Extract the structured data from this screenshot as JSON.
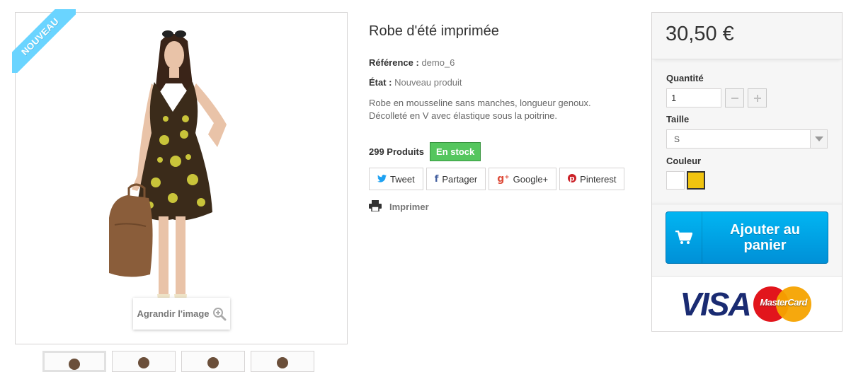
{
  "product": {
    "badge": "Nouveau",
    "zoom_label": "Agrandir l'image",
    "title": "Robe d'été imprimée",
    "reference_label": "Référence :",
    "reference_value": "demo_6",
    "condition_label": "État :",
    "condition_value": "Nouveau produit",
    "description_line1": "Robe en mousseline sans manches, longueur genoux.",
    "description_line2": "Décolleté en V avec élastique sous la poitrine.",
    "quantity_text": "299 Produits",
    "stock_badge": "En stock",
    "share": {
      "tweet": "Tweet",
      "partager": "Partager",
      "google": "Google+",
      "pinterest": "Pinterest"
    },
    "print_label": "Imprimer"
  },
  "buy_box": {
    "price": "30,50 €",
    "quantity_label": "Quantité",
    "quantity_value": "1",
    "size_label": "Taille",
    "size_value": "S",
    "color_label": "Couleur",
    "colors": [
      "#ffffff",
      "#f1c40f"
    ],
    "selected_color_index": 1,
    "add_to_cart": "Ajouter au panier",
    "payment_logos": [
      "VISA",
      "MasterCard"
    ]
  },
  "colors": {
    "ribbon": "#6ad4ff",
    "stock_green": "#55c65e",
    "cart_blue": "#0090d7"
  }
}
